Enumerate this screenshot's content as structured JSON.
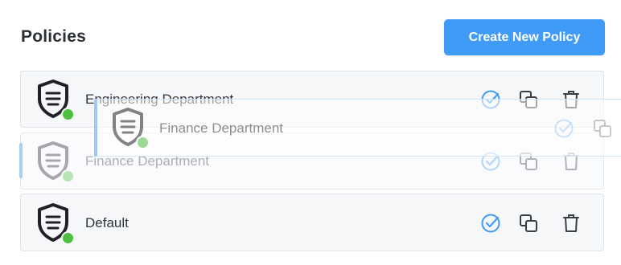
{
  "header": {
    "title": "Policies",
    "create_button_label": "Create New Policy"
  },
  "colors": {
    "accent": "#3f9bf5",
    "status_active": "#4cbf3f",
    "shield": "#1f2126",
    "check_icon": "#3f9bf5",
    "action_icon": "#3a3d44"
  },
  "policies": [
    {
      "name": "Engineering Department",
      "status": "active",
      "actions": [
        "check-icon",
        "copy-icon",
        "trash-icon"
      ]
    },
    {
      "name": "Finance Department",
      "status": "active",
      "state": "drag-placeholder",
      "actions": [
        "check-icon",
        "copy-icon",
        "trash-icon"
      ]
    },
    {
      "name": "Default",
      "status": "active",
      "actions": [
        "check-icon",
        "copy-icon",
        "trash-icon"
      ]
    }
  ],
  "drag_preview": {
    "name": "Finance Department"
  }
}
